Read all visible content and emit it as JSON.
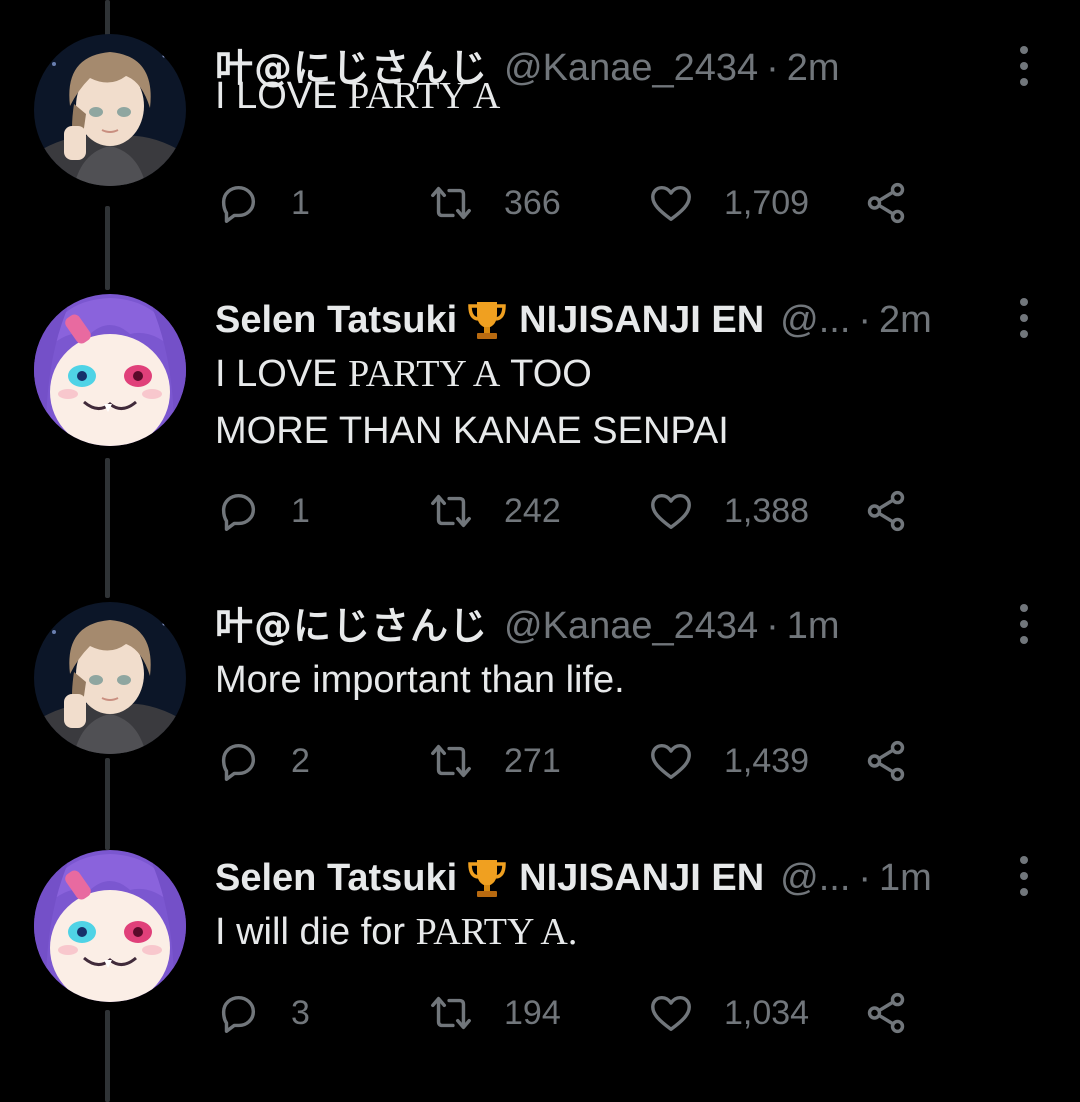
{
  "tweets": [
    {
      "author": "叶@にじさんじ",
      "handle": "@Kanae_2434",
      "separator": "·",
      "time": "2m",
      "org": "",
      "avatar": "kanae",
      "lines": [
        [
          {
            "text": "I LOVE ",
            "serif": false
          },
          {
            "text": "PARTY A",
            "serif": true
          }
        ]
      ],
      "replies": "1",
      "retweets": "366",
      "likes": "1,709"
    },
    {
      "author": "Selen Tatsuki",
      "handle": "@...",
      "separator": "·",
      "time": "2m",
      "org": "NIJISANJI EN",
      "avatar": "selen",
      "lines": [
        [
          {
            "text": "I LOVE ",
            "serif": false
          },
          {
            "text": "PARTY A",
            "serif": true
          },
          {
            "text": " TOO",
            "serif": false
          }
        ],
        [
          {
            "text": "MORE THAN KANAE SENPAI",
            "serif": false
          }
        ]
      ],
      "replies": "1",
      "retweets": "242",
      "likes": "1,388"
    },
    {
      "author": "叶@にじさんじ",
      "handle": "@Kanae_2434",
      "separator": "·",
      "time": "1m",
      "org": "",
      "avatar": "kanae",
      "lines": [
        [
          {
            "text": "More important than life.",
            "serif": false
          }
        ]
      ],
      "replies": "2",
      "retweets": "271",
      "likes": "1,439"
    },
    {
      "author": "Selen Tatsuki",
      "handle": "@...",
      "separator": "·",
      "time": "1m",
      "org": "NIJISANJI EN",
      "avatar": "selen",
      "lines": [
        [
          {
            "text": "I will die for ",
            "serif": false
          },
          {
            "text": "PARTY A",
            "serif": true
          },
          {
            "text": ".",
            "serif": true
          }
        ]
      ],
      "replies": "3",
      "retweets": "194",
      "likes": "1,034"
    }
  ],
  "icons": {
    "reply": "reply-icon",
    "retweet": "retweet-icon",
    "like": "heart-icon",
    "share": "share-icon",
    "more": "more-icon",
    "trophy": "trophy-icon"
  },
  "colors": {
    "background": "#000000",
    "text": "#e7e9ea",
    "muted": "#71767b",
    "thread_line": "#2f3336",
    "trophy": "#f0a020"
  }
}
